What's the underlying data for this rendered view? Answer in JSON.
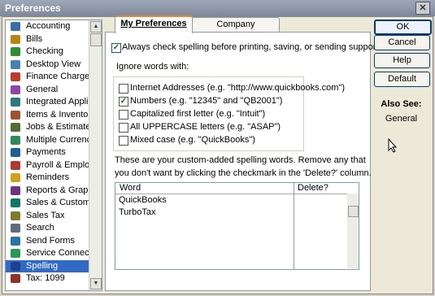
{
  "window": {
    "title": "Preferences",
    "close_glyph": "✕"
  },
  "sidebar": {
    "items": [
      {
        "label": "Accounting",
        "icon": "accounting-icon",
        "color": "#3a6ea5"
      },
      {
        "label": "Bills",
        "icon": "bills-icon",
        "color": "#b8860b"
      },
      {
        "label": "Checking",
        "icon": "checking-icon",
        "color": "#2f8f2f"
      },
      {
        "label": "Desktop View",
        "icon": "desktop-view-icon",
        "color": "#4682b4"
      },
      {
        "label": "Finance Charge",
        "icon": "finance-charge-icon",
        "color": "#c0392b"
      },
      {
        "label": "General",
        "icon": "general-icon",
        "color": "#8e44ad"
      },
      {
        "label": "Integrated Applicatio",
        "icon": "integrated-applications-icon",
        "color": "#2c7a7b"
      },
      {
        "label": "Items & Inventory",
        "icon": "items-inventory-icon",
        "color": "#a0522d"
      },
      {
        "label": "Jobs & Estimates",
        "icon": "jobs-estimates-icon",
        "color": "#556b2f"
      },
      {
        "label": "Multiple Currencies",
        "icon": "multiple-currencies-icon",
        "color": "#2e8b57"
      },
      {
        "label": "Payments",
        "icon": "payments-icon",
        "color": "#1e6091"
      },
      {
        "label": "Payroll & Employees",
        "icon": "payroll-employees-icon",
        "color": "#b03a2e"
      },
      {
        "label": "Reminders",
        "icon": "reminders-icon",
        "color": "#d4a017"
      },
      {
        "label": "Reports & Graphs",
        "icon": "reports-graphs-icon",
        "color": "#6c3483"
      },
      {
        "label": "Sales & Customers",
        "icon": "sales-customers-icon",
        "color": "#117864"
      },
      {
        "label": "Sales Tax",
        "icon": "sales-tax-icon",
        "color": "#7b7d2a"
      },
      {
        "label": "Search",
        "icon": "search-icon",
        "color": "#5d6d7e"
      },
      {
        "label": "Send Forms",
        "icon": "send-forms-icon",
        "color": "#2874a6"
      },
      {
        "label": "Service Connection",
        "icon": "service-connection-icon",
        "color": "#239b56"
      },
      {
        "label": "Spelling",
        "icon": "spelling-icon",
        "color": "#1f3f8f",
        "selected": true
      },
      {
        "label": "Tax: 1099",
        "icon": "tax-1099-icon",
        "color": "#943126"
      }
    ]
  },
  "tabs": [
    {
      "label": "My Preferences",
      "active": true
    },
    {
      "label": "Company Preferences",
      "active": false
    }
  ],
  "my_prefs": {
    "always_check": {
      "label": "Always check spelling before printing, saving, or sending supported forms",
      "checked": true
    },
    "ignore_group_label": "Ignore words with:",
    "ignore_options": [
      {
        "label": "Internet Addresses (e.g. \"http://www.quickbooks.com\")",
        "checked": false
      },
      {
        "label": "Numbers (e.g. \"12345\" and \"QB2001\")",
        "checked": true
      },
      {
        "label": "Capitalized first letter (e.g. \"Intuit\")",
        "checked": false
      },
      {
        "label": "All UPPERCASE letters (e.g. \"ASAP\")",
        "checked": false
      },
      {
        "label": "Mixed case (e.g. \"QuickBooks\")",
        "checked": false
      }
    ],
    "custom_words_text_1": "These are your custom-added spelling words.  Remove any that",
    "custom_words_text_2": "you don't want by clicking the checkmark in the 'Delete?' column.",
    "table": {
      "columns": [
        "Word",
        "Delete?"
      ],
      "rows": [
        "QuickBooks",
        "TurboTax"
      ]
    }
  },
  "buttons": {
    "ok": "OK",
    "cancel": "Cancel",
    "help": "Help",
    "default": "Default"
  },
  "also_see": {
    "title": "Also See:",
    "link": "General"
  }
}
